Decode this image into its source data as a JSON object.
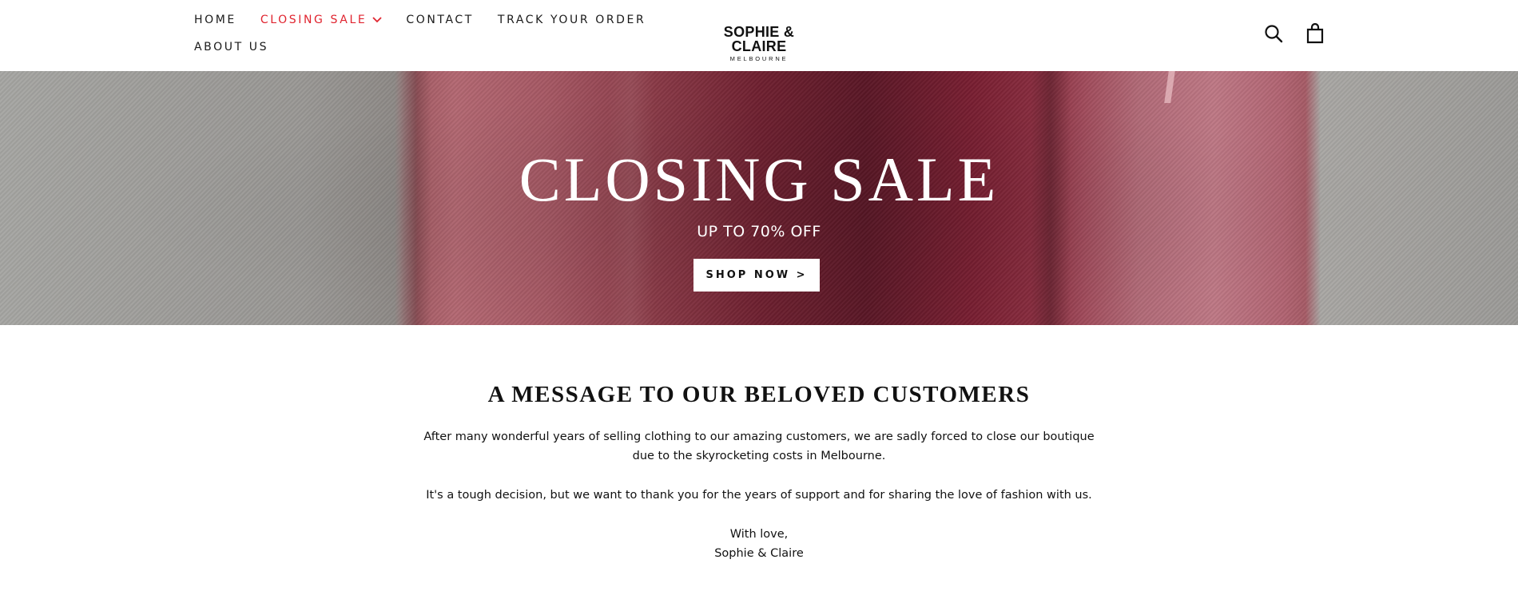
{
  "header": {
    "nav": {
      "home": "HOME",
      "closing_sale": "CLOSING SALE",
      "contact": "CONTACT",
      "track_order": "TRACK YOUR ORDER",
      "about_us": "ABOUT US"
    },
    "logo": {
      "name": "SOPHIE & CLAIRE",
      "location": "MELBOURNE"
    },
    "icons": [
      "search-icon",
      "cart-icon",
      "chevron-down-icon"
    ],
    "accent_color": "#e0242f"
  },
  "hero": {
    "title": "CLOSING SALE",
    "subtitle": "UP TO 70% OFF",
    "button_label": "SHOP NOW >"
  },
  "message": {
    "title": "A MESSAGE TO OUR BELOVED CUSTOMERS",
    "paragraph1": "After many wonderful years of selling clothing to our amazing customers, we are sadly forced to close our boutique due to the skyrocketing costs in Melbourne.",
    "paragraph2": "It's a tough decision, but we want to thank you for the years of support and for sharing the love of fashion with us.",
    "signoff_line1": "With love,",
    "signoff_line2": "Sophie & Claire"
  }
}
